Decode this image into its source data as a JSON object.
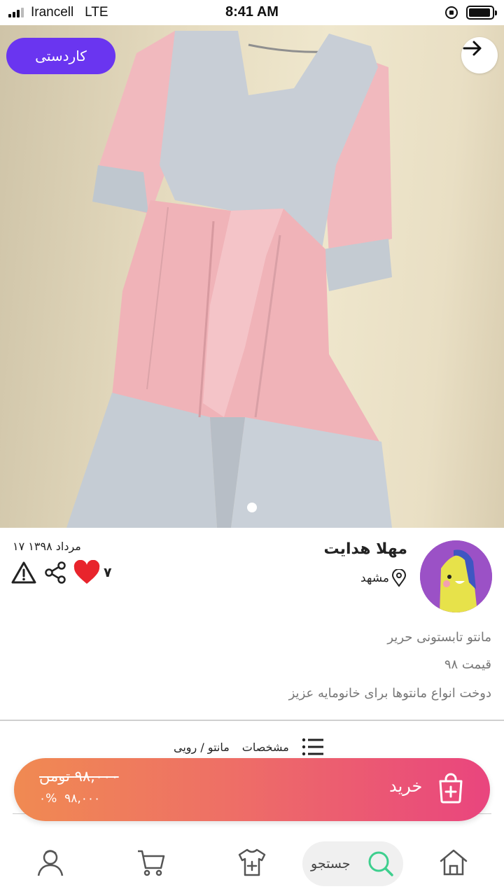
{
  "status_bar": {
    "carrier": "Irancell",
    "network": "LTE",
    "time": "8:41 AM"
  },
  "product": {
    "category_chip": "کاردستی",
    "image_count": 1,
    "active_image": 1
  },
  "seller": {
    "name": "مهلا هدایت",
    "location": "مشهد",
    "date": "مرداد ۱۳۹۸ ۱۷",
    "likes": "۷"
  },
  "description": {
    "title": "مانتو تابستونی حریر",
    "price_line": "قیمت ۹۸",
    "body": "دوخت انواع مانتوها برای خانومایه عزیز"
  },
  "specs": {
    "label": "مشخصات",
    "category_path": "مانتو / رویی"
  },
  "buy": {
    "label": "خرید",
    "old_price": "۹۸,۰۰۰ تومن",
    "new_price": "۹۸,۰۰۰",
    "discount": "۰%"
  },
  "nav": {
    "search_label": "جستجو"
  },
  "colors": {
    "accent_purple": "#6a35f0",
    "buy_gradient_start": "#f08a52",
    "buy_gradient_end": "#e9457e",
    "heart": "#e8242c",
    "search_icon": "#3ecf8e"
  },
  "icons": [
    "arrow-right-icon",
    "location-pin-icon",
    "warning-icon",
    "share-icon",
    "heart-icon",
    "list-icon",
    "shopping-bag-plus-icon",
    "home-icon",
    "search-icon",
    "add-clothing-icon",
    "cart-icon",
    "profile-icon"
  ]
}
